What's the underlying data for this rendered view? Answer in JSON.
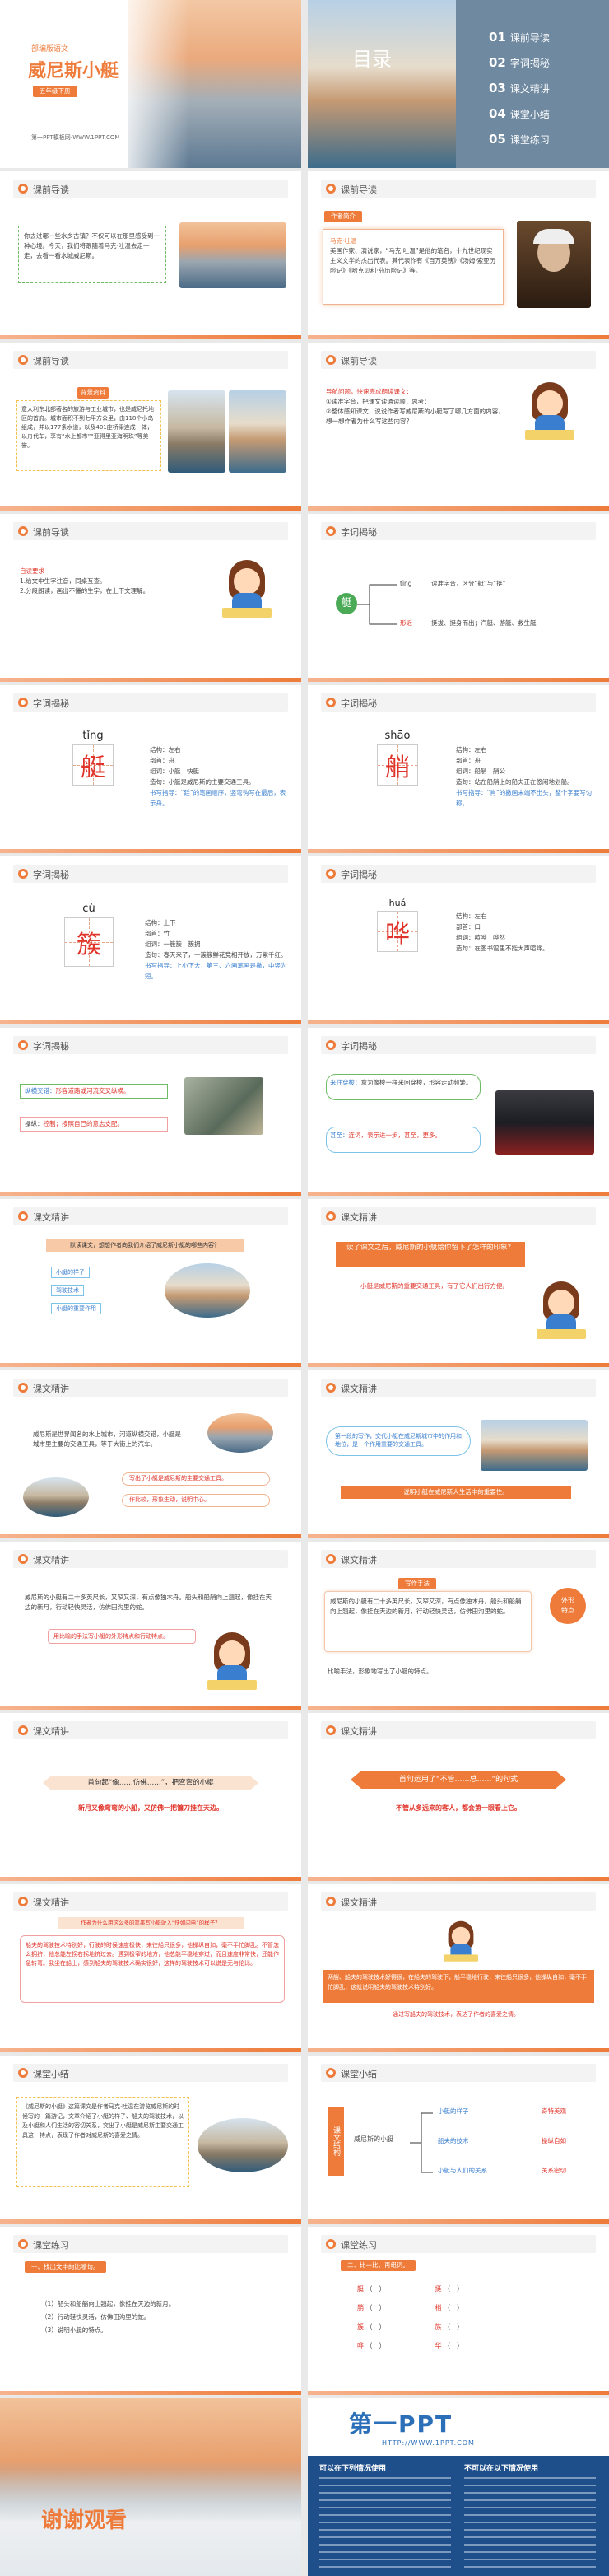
{
  "cover": {
    "series": "部编版语文",
    "title": "威尼斯小艇",
    "grade": "五年级下册",
    "site": "第一PPT模板网-WWW.1PPT.COM"
  },
  "toc": {
    "title": "目录",
    "items": [
      {
        "n": "01",
        "t": "课前导读"
      },
      {
        "n": "02",
        "t": "字词揭秘"
      },
      {
        "n": "03",
        "t": "课文精讲"
      },
      {
        "n": "04",
        "t": "课堂小结"
      },
      {
        "n": "05",
        "t": "课堂练习"
      }
    ]
  },
  "labels": {
    "pre": "课前导读",
    "words": "字词揭秘",
    "text": "课文精讲",
    "sum": "课堂小结",
    "prac": "课堂练习"
  },
  "s3": {
    "text": "你去过哪一些水乡古镇？不仅可以在那里感受到一种心境。今天，我们将跟随着马克·吐温去走一走，去看一看水城威尼斯。"
  },
  "s4": {
    "tag": "作者简介",
    "title": "马克·吐温",
    "body": "美国作家、演说家，“马克·吐温”是他的笔名，十九世纪现实主义文学的杰出代表。其代表作有《百万英镑》《汤姆·索亚历险记》《哈克贝利·芬历险记》等。"
  },
  "s5": {
    "tag": "背景资料",
    "text": "意大利东北部著名的旅游与工业城市，也是威尼托地区的首府。城市面积不到七平方公里，由118个小岛组成，并以177条水道，以及401座桥梁连成一体，以舟代车，享有“水上都市”“亚得里亚海明珠”等美誉。"
  },
  "s6": {
    "title": "导航问题，快速完成朗读课文：",
    "q1": "①读准字音，把课文读通读顺，思考：",
    "q2": "②整体感知课文，说说作者写威尼斯的小艇写了哪几方面的内容，想一想作者为什么写这些内容？"
  },
  "s7": {
    "title": "自读要求",
    "q1": "1.给文中生字注音，同桌互查。",
    "q2": "2.分段朗读，画出不懂的生字，在上下文理解。"
  },
  "s8": {
    "center": "艇",
    "top_lbl": "tǐng",
    "top_desc": "读准字音，区分“艇”与“挺”",
    "bot_lbl": "形近",
    "bot_desc": "挺拔、挺身而出；汽艇、游艇、救生艇"
  },
  "s9": {
    "pinyin": "tǐng",
    "char": "艇",
    "l1": "结构：左右",
    "l2": "部首：舟",
    "l3": "组词：小艇　快艇",
    "l4": "造句：小艇是威尼斯的主要交通工具。",
    "tip": "书写指导：“廷”的笔画顺序，竖弯钩写在最后，表示舟。"
  },
  "s10": {
    "pinyin": "shāo",
    "char": "艄",
    "l1": "结构：左右",
    "l2": "部首：舟",
    "l3": "组词：船艄　艄公",
    "l4": "造句：站在船艄上的船夫正在悠闲地划船。",
    "tip": "书写指导：“肖”的撇画末端不出头，整个字要写匀称。"
  },
  "s11": {
    "pinyin": "cù",
    "char": "簇",
    "l1": "结构：上下",
    "l2": "部首：竹",
    "l3": "组词：一簇簇　簇拥",
    "l4": "造句：春天来了，一簇簇鲜花竞相开放，万紫千红。",
    "tip": "书写指导：上小下大，第三、六画笔画是撇，中竖为短。"
  },
  "s12": {
    "pinyin": "huá",
    "char": "哗",
    "l1": "结构：左右",
    "l2": "部首：口",
    "l3": "组词：喧哗　哗然",
    "l4": "造句：在图书馆里不能大声喧哗。"
  },
  "s13": {
    "w1": "纵横交错：",
    "d1": "形容道路或河流交叉纵横。",
    "w2": "操纵：",
    "d2": "控制；按照自己的意志支配。"
  },
  "s14": {
    "w1": "来往穿梭：",
    "d1": "意为像梭一样来回穿梭，形容走动频繁。",
    "w2": "甚至：",
    "d2": "连词，表示进一步，甚至，更多。"
  },
  "s15": {
    "q": "默读课文，想想作者向我们介绍了威尼斯小艇的哪些内容？",
    "a1": "小艇的样子",
    "a2": "驾驶技术",
    "a3": "小艇的重要作用"
  },
  "s16": {
    "q": "读了课文之后，威尼斯的小艇给你留下了怎样的印象？",
    "a": "小艇是威尼斯的重要交通工具，有了它人们出行方便。"
  },
  "s17": {
    "text": "威尼斯是世界闻名的水上城市，河道纵横交错，小艇是城市里主要的交通工具，等于大街上的汽车。",
    "box1": "写出了小艇是威尼斯的主要交通工具。",
    "box2": "作比较，形象生动，说明中心。"
  },
  "s18": {
    "text": "第一段的写作，交代小艇在威尼斯城市中的作用和地位，是一个作用重要的交通工具。",
    "bar": "说明小艇在威尼斯人生活中的重要性。"
  },
  "s19": {
    "text": "威尼斯的小艇有二十多英尺长，又窄又深，有点像独木舟。船头和船艄向上翘起，像挂在天边的新月，行动轻快灵活，仿佛田沟里的蛇。",
    "note": "用比喻的手法写小艇的外形特点和行动特点。"
  },
  "s20": {
    "tag": "写作手法",
    "text": "威尼斯的小艇有二十多英尺长，又窄又深，有点像独木舟。船头和船艄向上翘起，像挂在天边的新月，行动轻快灵活，仿佛田沟里的蛇。",
    "s1": "外形",
    "s2": "特点",
    "bottom": "比喻手法，形象地写出了小艇的特点。"
  },
  "s21": {
    "banner": "首句起“像……仿佛……”，把弯弯的小艇",
    "sub": "新月又像弯弯的小船，又仿佛一把镰刀挂在天边。"
  },
  "s22": {
    "banner": "首句运用了“不管……总……”的句式",
    "sub": "不管从多远来的客人，都会第一眼看上它。"
  },
  "s23": {
    "bar": "作者为什么用这么多的笔墨写小艇驶入“快如闪电”的样子？",
    "text": "船夫的驾驶技术特别好，行驶的时候速度极快，来往船只很多，他操纵自如，毫不手忙脚乱。不管怎么拥挤，他总能左拐右拐地挤过去。遇到极窄的地方，他总能平稳地穿过，而且速度非常快，还能作急转弯。我坐在船上，感到船夫的驾驶技术确实很好，这样的驾驶技术可以说是无与伦比。"
  },
  "s24": {
    "text": "两艘、船夫的驾驶技术好得很，在船夫的驾驶下，船平稳地行驶，来往船只很多，他操纵自如，毫不手忙脚乱，这就说明船夫的驾驶技术特别好。",
    "bottom": "通过写船夫的驾驶技术，表达了作者的喜爱之情。"
  },
  "s25": {
    "text": "《威尼斯的小艇》这篇课文是作者马克·吐温在游览威尼斯的时候写的一篇游记，文章介绍了小艇的样子、船夫的驾驶技术，以及小艇和人们生活的密切关系，突出了小艇是威尼斯主要交通工具这一特点，表现了作者对威尼斯的喜爱之情。"
  },
  "s26": {
    "vert": "课文结构",
    "center": "威尼斯的小艇",
    "b1": "小艇的样子",
    "b2": "船夫的技术",
    "b3": "小艇与人们的关系",
    "r1": "奇特美观",
    "r2": "操纵自如",
    "r3": "关系密切"
  },
  "s27": {
    "tag": "一、找出文中的比喻句。",
    "l1": "（1）船头和船艄向上翘起，像挂在天边的新月。",
    "l2": "（2）行动轻快灵活，仿佛田沟里的蛇。",
    "l3": "（3）说明小艇的特点。"
  },
  "s28": {
    "tag": "二、比一比，再组词。",
    "rows": [
      [
        "艇",
        "（　）",
        "挺",
        "（　）"
      ],
      [
        "艄",
        "（　）",
        "梢",
        "（　）"
      ],
      [
        "簇",
        "（　）",
        "族",
        "（　）"
      ],
      [
        "哗",
        "（　）",
        "华",
        "（　）"
      ]
    ]
  },
  "s29": {
    "text": "谢谢观看"
  },
  "s30": {
    "logo": "第一PPT",
    "url": "HTTP://WWW.1PPT.COM",
    "h1": "可以在下列情况使用",
    "h2": "不可以在以下情况使用"
  }
}
